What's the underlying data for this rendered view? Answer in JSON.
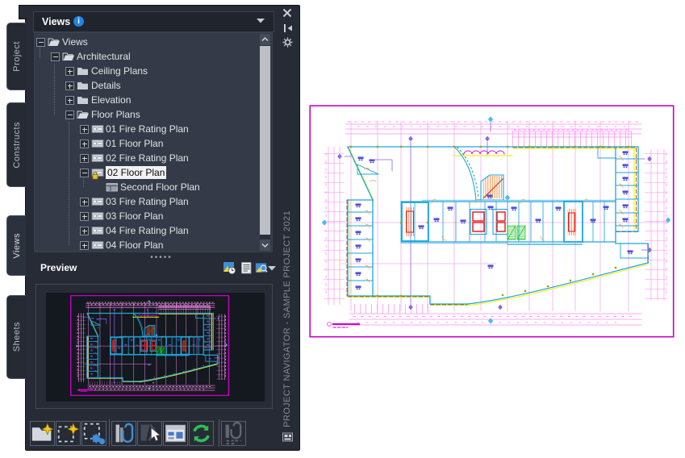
{
  "palette": {
    "title": "Views",
    "tabs": [
      {
        "label": "Project",
        "active": false
      },
      {
        "label": "Constructs",
        "active": false
      },
      {
        "label": "Views",
        "active": true
      },
      {
        "label": "Sheets",
        "active": false
      }
    ],
    "vertical_caption": "PROJECT NAVIGATOR - SAMPLE PROJECT 2021",
    "tree": {
      "items": [
        {
          "label": "Views",
          "depth": 0,
          "exp": "minus",
          "icon": "folder-open",
          "selected": false
        },
        {
          "label": "Architectural",
          "depth": 1,
          "exp": "minus",
          "icon": "folder-open",
          "selected": false
        },
        {
          "label": "Ceiling Plans",
          "depth": 2,
          "exp": "plus",
          "icon": "folder",
          "selected": false
        },
        {
          "label": "Details",
          "depth": 2,
          "exp": "plus",
          "icon": "folder",
          "selected": false
        },
        {
          "label": "Elevation",
          "depth": 2,
          "exp": "plus",
          "icon": "folder",
          "selected": false
        },
        {
          "label": "Floor Plans",
          "depth": 2,
          "exp": "minus",
          "icon": "folder-open",
          "selected": false
        },
        {
          "label": "01 Fire Rating Plan",
          "depth": 3,
          "exp": "plus",
          "icon": "view",
          "selected": false
        },
        {
          "label": "01 Floor Plan",
          "depth": 3,
          "exp": "plus",
          "icon": "view",
          "selected": false
        },
        {
          "label": "02 Fire Rating Plan",
          "depth": 3,
          "exp": "plus",
          "icon": "view",
          "selected": false
        },
        {
          "label": "02 Floor Plan",
          "depth": 3,
          "exp": "minus",
          "icon": "view-locked",
          "selected": true
        },
        {
          "label": "Second Floor Plan",
          "depth": 4,
          "exp": null,
          "icon": "viewport",
          "selected": false
        },
        {
          "label": "03 Fire Rating Plan",
          "depth": 3,
          "exp": "plus",
          "icon": "view",
          "selected": false
        },
        {
          "label": "03 Floor Plan",
          "depth": 3,
          "exp": "plus",
          "icon": "view",
          "selected": false
        },
        {
          "label": "04 Fire Rating Plan",
          "depth": 3,
          "exp": "plus",
          "icon": "view",
          "selected": false
        },
        {
          "label": "04 Floor Plan",
          "depth": 3,
          "exp": "plus",
          "icon": "view",
          "selected": false
        }
      ]
    },
    "preview": {
      "label": "Preview"
    },
    "toolbar": {
      "buttons": [
        "add-category",
        "add-view",
        "add-view-auto",
        "attach-tool",
        "hide-tool",
        "properties-tool",
        "refresh",
        "attach-disabled"
      ]
    }
  },
  "drawing": {
    "type": "floor-plan",
    "colors": {
      "frame": "#c800c8",
      "dims": "#ff8af2",
      "grid": "#e589e5",
      "wall": "#1ca6dd",
      "accent_yellow": "#f2f216",
      "stair_orange": "#f5812f",
      "elevator_red": "#ee1111",
      "green": "#16c016",
      "label_blue": "#5050d8",
      "marker_violet": "#8d63e8",
      "marker_cyan": "#49bdf0",
      "tick_olive": "#a3a300",
      "wall_brown": "#a24a1a"
    }
  }
}
